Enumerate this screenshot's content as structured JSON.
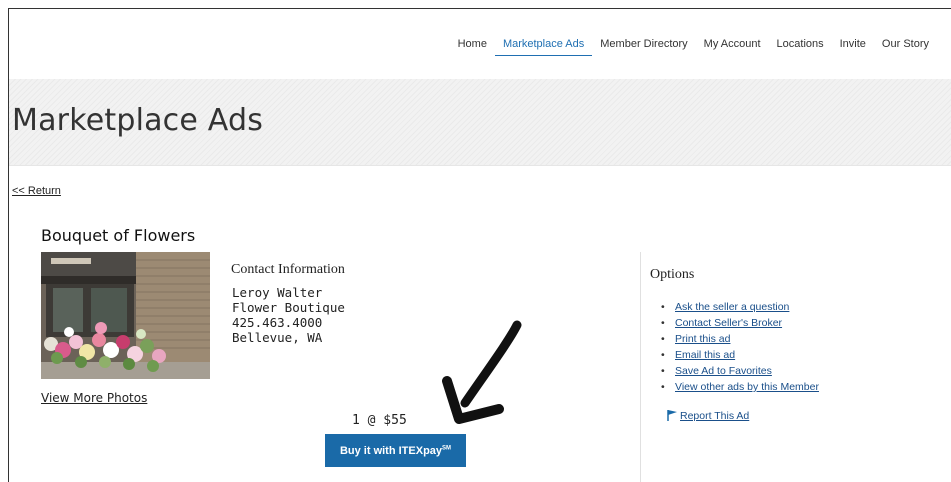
{
  "nav": {
    "items": [
      {
        "label": "Home",
        "active": false
      },
      {
        "label": "Marketplace Ads",
        "active": true
      },
      {
        "label": "Member Directory",
        "active": false
      },
      {
        "label": "My Account",
        "active": false
      },
      {
        "label": "Locations",
        "active": false
      },
      {
        "label": "Invite",
        "active": false
      },
      {
        "label": "Our Story",
        "active": false
      }
    ],
    "active_color": "#1f6fb2"
  },
  "hero": {
    "title": "Marketplace Ads"
  },
  "return_link": "<< Return",
  "ad": {
    "title": "Bouquet of Flowers",
    "view_more": "View More Photos",
    "contact_heading": "Contact Information",
    "contact_lines": [
      "Leroy Walter",
      "Flower Boutique",
      "425.463.4000",
      "Bellevue, WA"
    ],
    "qty_price": "1 @ $55",
    "buy_label": "Buy it with ITEXpay",
    "buy_mark": "SM",
    "buy_color": "#1a6aa8"
  },
  "options": {
    "heading": "Options",
    "items": [
      "Ask the seller a question",
      "Contact Seller's Broker",
      "Print this ad",
      "Email this ad",
      "Save Ad to Favorites",
      "View other ads by this Member"
    ],
    "report": "Report This Ad",
    "report_icon": "flag-icon"
  }
}
